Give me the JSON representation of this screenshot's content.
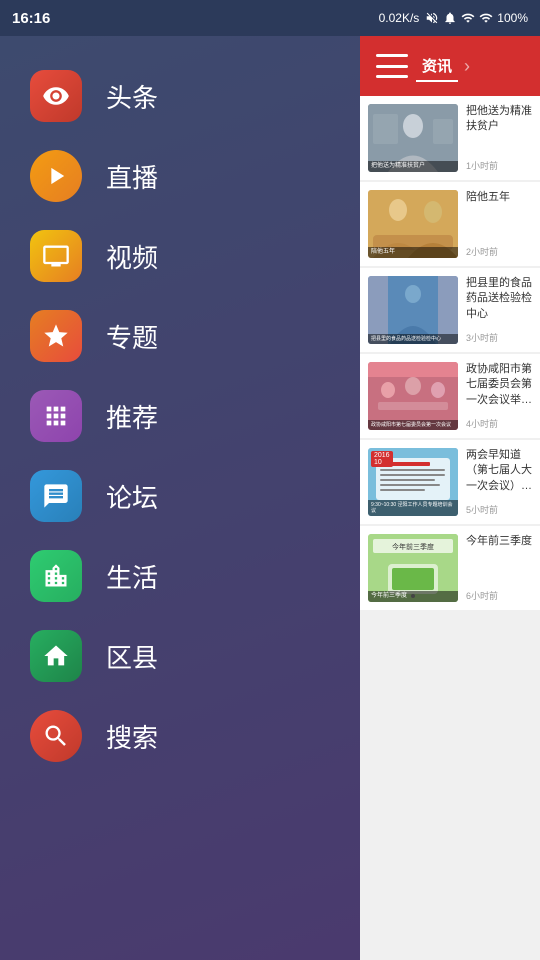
{
  "statusBar": {
    "time": "16:16",
    "network": "0.02K/s",
    "battery": "100%"
  },
  "sidebar": {
    "items": [
      {
        "id": "toutiao",
        "label": "头条",
        "iconClass": "icon-red",
        "iconType": "eye"
      },
      {
        "id": "zhibo",
        "label": "直播",
        "iconClass": "icon-orange-play",
        "iconType": "play"
      },
      {
        "id": "shipin",
        "label": "视频",
        "iconClass": "icon-yellow",
        "iconType": "tv"
      },
      {
        "id": "zhuanti",
        "label": "专题",
        "iconClass": "icon-orange-star",
        "iconType": "star"
      },
      {
        "id": "tuijian",
        "label": "推荐",
        "iconClass": "icon-purple",
        "iconType": "grid"
      },
      {
        "id": "luntan",
        "label": "论坛",
        "iconClass": "icon-blue",
        "iconType": "chat"
      },
      {
        "id": "shenghuo",
        "label": "生活",
        "iconClass": "icon-green",
        "iconType": "building"
      },
      {
        "id": "quxian",
        "label": "区县",
        "iconClass": "icon-green-dark",
        "iconType": "home"
      },
      {
        "id": "sousuo",
        "label": "搜索",
        "iconClass": "icon-red-search",
        "iconType": "search"
      }
    ]
  },
  "rightPanel": {
    "tabs": [
      {
        "id": "zixun",
        "label": "资讯",
        "active": true
      },
      {
        "id": "tab2",
        "label": "",
        "active": false
      }
    ],
    "news": [
      {
        "id": 1,
        "title": "把他送为精准扶贫户",
        "time": "1小时前",
        "thumbClass": "thumb-1",
        "hasPlay": false,
        "bottomText": ""
      },
      {
        "id": 2,
        "title": "陪他五年",
        "time": "2小时前",
        "thumbClass": "thumb-2",
        "hasPlay": false,
        "bottomText": "陪他五年"
      },
      {
        "id": 3,
        "title": "把县里的食品药品送检验检中心",
        "time": "3小时前",
        "thumbClass": "thumb-3",
        "hasPlay": false,
        "bottomText": "把县里的食品药品送检验检中心"
      },
      {
        "id": 4,
        "title": "政协咸阳市第七届委员会第一次会议举行召集人会议",
        "time": "4小时前",
        "thumbClass": "thumb-4",
        "hasPlay": false,
        "bottomText": "政协咸阳市第七届委员会\n第一次会议举行召集人会议"
      },
      {
        "id": 5,
        "title": "两会早知道（第七届人大一次会议）泾阳工作人员专题培训会议",
        "time": "5小时前",
        "thumbClass": "thumb-5",
        "hasPlay": false,
        "tag": "2016 10",
        "timeText": "9:30~10:30",
        "bottomText": "泾阳工作人员专题培训会议"
      },
      {
        "id": 6,
        "title": "今年前三季度",
        "time": "6小时前",
        "thumbClass": "thumb-6",
        "hasPlay": false,
        "bottomText": "今年前三季度"
      }
    ]
  }
}
